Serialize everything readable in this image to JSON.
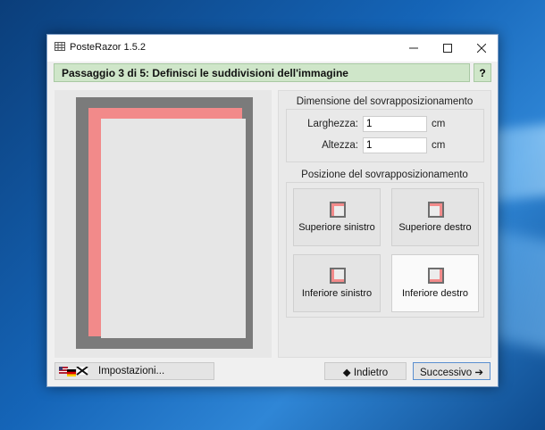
{
  "window": {
    "title": "PosteRazor 1.5.2"
  },
  "step": {
    "title": "Passaggio 3 di 5: Definisci le suddivisioni dell'immagine",
    "help_label": "?"
  },
  "overlap_size": {
    "title": "Dimensione del sovrapposizionamento",
    "width_label": "Larghezza:",
    "width_value": "1",
    "height_label": "Altezza:",
    "height_value": "1",
    "unit": "cm"
  },
  "overlap_position": {
    "title": "Posizione del sovrapposizionamento",
    "options": [
      {
        "label": "Superiore sinistro",
        "selected": false
      },
      {
        "label": "Superiore destro",
        "selected": false
      },
      {
        "label": "Inferiore sinistro",
        "selected": false
      },
      {
        "label": "Inferiore destro",
        "selected": true
      }
    ]
  },
  "footer": {
    "settings_label": "Impostazioni...",
    "back_label": "◆ Indietro",
    "next_label": "Successivo ➔"
  },
  "colors": {
    "overlap": "#f28a8a",
    "step_bar": "#cfe6c9",
    "page": "#e6e6e6",
    "border": "#7b7b7b"
  },
  "icons": [
    "app-icon",
    "minimize-icon",
    "maximize-icon",
    "close-icon",
    "flags-icon",
    "overlap-position-icon"
  ]
}
